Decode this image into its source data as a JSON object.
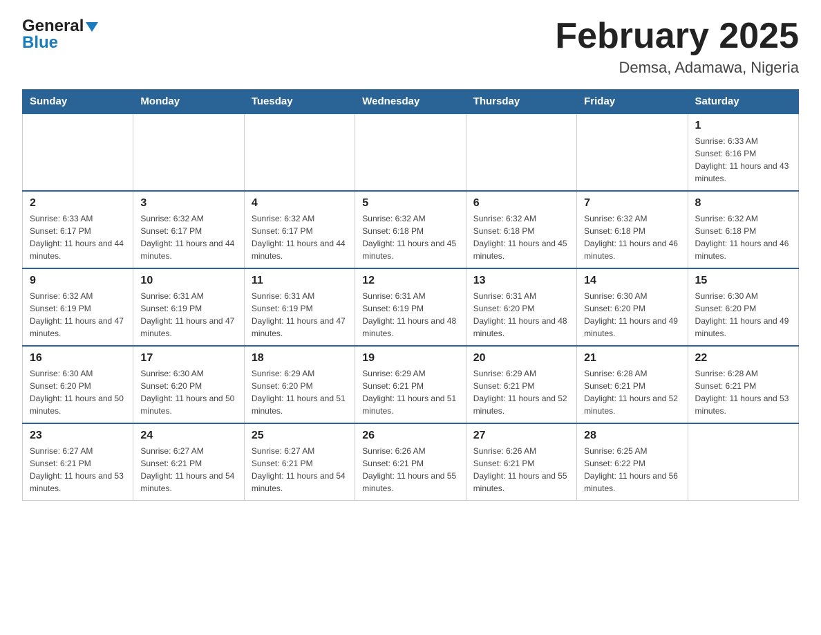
{
  "header": {
    "logo_general": "General",
    "logo_blue": "Blue",
    "title": "February 2025",
    "subtitle": "Demsa, Adamawa, Nigeria"
  },
  "weekdays": [
    "Sunday",
    "Monday",
    "Tuesday",
    "Wednesday",
    "Thursday",
    "Friday",
    "Saturday"
  ],
  "weeks": [
    [
      {
        "day": "",
        "sunrise": "",
        "sunset": "",
        "daylight": ""
      },
      {
        "day": "",
        "sunrise": "",
        "sunset": "",
        "daylight": ""
      },
      {
        "day": "",
        "sunrise": "",
        "sunset": "",
        "daylight": ""
      },
      {
        "day": "",
        "sunrise": "",
        "sunset": "",
        "daylight": ""
      },
      {
        "day": "",
        "sunrise": "",
        "sunset": "",
        "daylight": ""
      },
      {
        "day": "",
        "sunrise": "",
        "sunset": "",
        "daylight": ""
      },
      {
        "day": "1",
        "sunrise": "Sunrise: 6:33 AM",
        "sunset": "Sunset: 6:16 PM",
        "daylight": "Daylight: 11 hours and 43 minutes."
      }
    ],
    [
      {
        "day": "2",
        "sunrise": "Sunrise: 6:33 AM",
        "sunset": "Sunset: 6:17 PM",
        "daylight": "Daylight: 11 hours and 44 minutes."
      },
      {
        "day": "3",
        "sunrise": "Sunrise: 6:32 AM",
        "sunset": "Sunset: 6:17 PM",
        "daylight": "Daylight: 11 hours and 44 minutes."
      },
      {
        "day": "4",
        "sunrise": "Sunrise: 6:32 AM",
        "sunset": "Sunset: 6:17 PM",
        "daylight": "Daylight: 11 hours and 44 minutes."
      },
      {
        "day": "5",
        "sunrise": "Sunrise: 6:32 AM",
        "sunset": "Sunset: 6:18 PM",
        "daylight": "Daylight: 11 hours and 45 minutes."
      },
      {
        "day": "6",
        "sunrise": "Sunrise: 6:32 AM",
        "sunset": "Sunset: 6:18 PM",
        "daylight": "Daylight: 11 hours and 45 minutes."
      },
      {
        "day": "7",
        "sunrise": "Sunrise: 6:32 AM",
        "sunset": "Sunset: 6:18 PM",
        "daylight": "Daylight: 11 hours and 46 minutes."
      },
      {
        "day": "8",
        "sunrise": "Sunrise: 6:32 AM",
        "sunset": "Sunset: 6:18 PM",
        "daylight": "Daylight: 11 hours and 46 minutes."
      }
    ],
    [
      {
        "day": "9",
        "sunrise": "Sunrise: 6:32 AM",
        "sunset": "Sunset: 6:19 PM",
        "daylight": "Daylight: 11 hours and 47 minutes."
      },
      {
        "day": "10",
        "sunrise": "Sunrise: 6:31 AM",
        "sunset": "Sunset: 6:19 PM",
        "daylight": "Daylight: 11 hours and 47 minutes."
      },
      {
        "day": "11",
        "sunrise": "Sunrise: 6:31 AM",
        "sunset": "Sunset: 6:19 PM",
        "daylight": "Daylight: 11 hours and 47 minutes."
      },
      {
        "day": "12",
        "sunrise": "Sunrise: 6:31 AM",
        "sunset": "Sunset: 6:19 PM",
        "daylight": "Daylight: 11 hours and 48 minutes."
      },
      {
        "day": "13",
        "sunrise": "Sunrise: 6:31 AM",
        "sunset": "Sunset: 6:20 PM",
        "daylight": "Daylight: 11 hours and 48 minutes."
      },
      {
        "day": "14",
        "sunrise": "Sunrise: 6:30 AM",
        "sunset": "Sunset: 6:20 PM",
        "daylight": "Daylight: 11 hours and 49 minutes."
      },
      {
        "day": "15",
        "sunrise": "Sunrise: 6:30 AM",
        "sunset": "Sunset: 6:20 PM",
        "daylight": "Daylight: 11 hours and 49 minutes."
      }
    ],
    [
      {
        "day": "16",
        "sunrise": "Sunrise: 6:30 AM",
        "sunset": "Sunset: 6:20 PM",
        "daylight": "Daylight: 11 hours and 50 minutes."
      },
      {
        "day": "17",
        "sunrise": "Sunrise: 6:30 AM",
        "sunset": "Sunset: 6:20 PM",
        "daylight": "Daylight: 11 hours and 50 minutes."
      },
      {
        "day": "18",
        "sunrise": "Sunrise: 6:29 AM",
        "sunset": "Sunset: 6:20 PM",
        "daylight": "Daylight: 11 hours and 51 minutes."
      },
      {
        "day": "19",
        "sunrise": "Sunrise: 6:29 AM",
        "sunset": "Sunset: 6:21 PM",
        "daylight": "Daylight: 11 hours and 51 minutes."
      },
      {
        "day": "20",
        "sunrise": "Sunrise: 6:29 AM",
        "sunset": "Sunset: 6:21 PM",
        "daylight": "Daylight: 11 hours and 52 minutes."
      },
      {
        "day": "21",
        "sunrise": "Sunrise: 6:28 AM",
        "sunset": "Sunset: 6:21 PM",
        "daylight": "Daylight: 11 hours and 52 minutes."
      },
      {
        "day": "22",
        "sunrise": "Sunrise: 6:28 AM",
        "sunset": "Sunset: 6:21 PM",
        "daylight": "Daylight: 11 hours and 53 minutes."
      }
    ],
    [
      {
        "day": "23",
        "sunrise": "Sunrise: 6:27 AM",
        "sunset": "Sunset: 6:21 PM",
        "daylight": "Daylight: 11 hours and 53 minutes."
      },
      {
        "day": "24",
        "sunrise": "Sunrise: 6:27 AM",
        "sunset": "Sunset: 6:21 PM",
        "daylight": "Daylight: 11 hours and 54 minutes."
      },
      {
        "day": "25",
        "sunrise": "Sunrise: 6:27 AM",
        "sunset": "Sunset: 6:21 PM",
        "daylight": "Daylight: 11 hours and 54 minutes."
      },
      {
        "day": "26",
        "sunrise": "Sunrise: 6:26 AM",
        "sunset": "Sunset: 6:21 PM",
        "daylight": "Daylight: 11 hours and 55 minutes."
      },
      {
        "day": "27",
        "sunrise": "Sunrise: 6:26 AM",
        "sunset": "Sunset: 6:21 PM",
        "daylight": "Daylight: 11 hours and 55 minutes."
      },
      {
        "day": "28",
        "sunrise": "Sunrise: 6:25 AM",
        "sunset": "Sunset: 6:22 PM",
        "daylight": "Daylight: 11 hours and 56 minutes."
      },
      {
        "day": "",
        "sunrise": "",
        "sunset": "",
        "daylight": ""
      }
    ]
  ]
}
